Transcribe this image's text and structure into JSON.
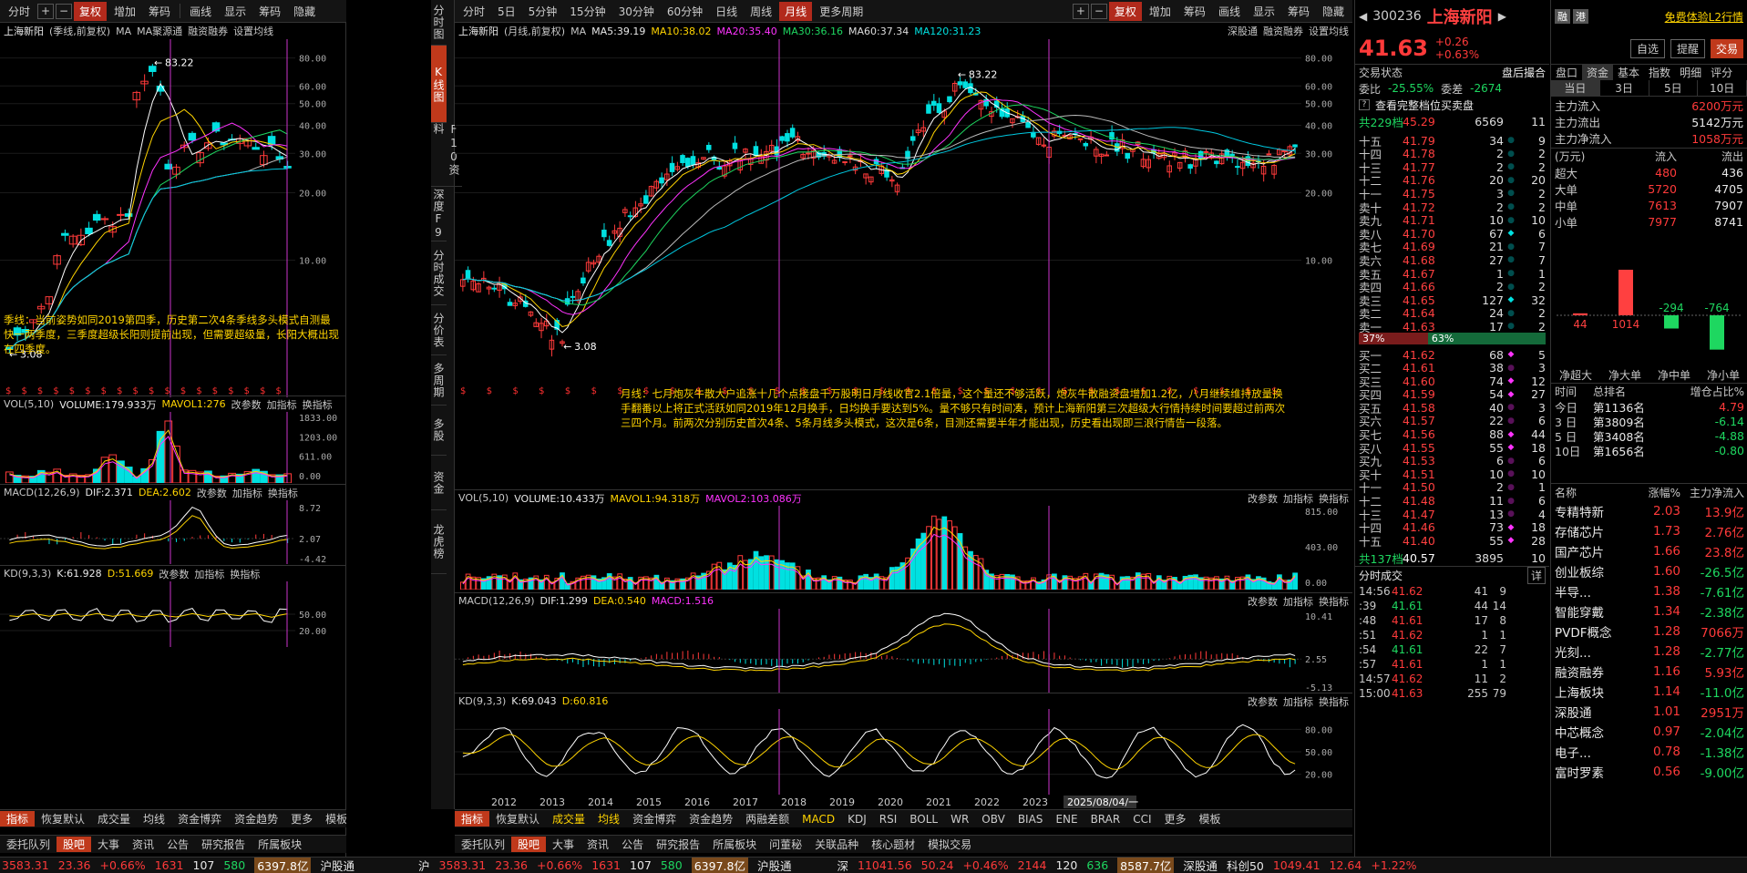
{
  "toolbar": {
    "left": [
      "分时",
      "+",
      "−",
      "复权",
      "增加",
      "筹码",
      "画线",
      "显示",
      "筹码",
      "隐藏"
    ],
    "mid": [
      "分时",
      "5日",
      "5分钟",
      "15分钟",
      "30分钟",
      "60分钟",
      "日线",
      "周线",
      "月线",
      "更多周期"
    ],
    "mid_right": [
      "+",
      "−",
      "复权",
      "增加",
      "筹码",
      "画线",
      "显示",
      "筹码",
      "隐藏"
    ]
  },
  "left_chart": {
    "title": "上海新阳",
    "sub": "(季线,前复权)",
    "ma_label": "MA",
    "ma2": "MA聚源通",
    "links": [
      "融资融券",
      "设置均线"
    ],
    "high": "83.22",
    "low": "3.08",
    "yticks": [
      "80.00",
      "60.00",
      "50.00",
      "40.00",
      "30.00",
      "20.00",
      "10.00"
    ],
    "note": "季线：当前姿势如同2019第四季，历史第二次4条季线多头模式自测最快一两季度，三季度超级长阳则提前出现，但需要超级量，长阳大概出现在四季度。",
    "vol": {
      "label": "VOL(5,10)",
      "volume": "VOLUME:179.933万",
      "mavol1": "MAVOL1:276",
      "links": [
        "改参数",
        "加指标",
        "换指标"
      ],
      "yticks": [
        "1833.00",
        "1203.00",
        "611.00",
        "0.00"
      ]
    },
    "macd": {
      "label": "MACD(12,26,9)",
      "dif": "DIF:2.371",
      "dea": "DEA:2.602",
      "links": [
        "改参数",
        "加指标",
        "换指标"
      ],
      "yticks": [
        "8.72",
        "2.07",
        "-4.42"
      ]
    },
    "kd": {
      "label": "KD(9,3,3)",
      "k": "K:61.928",
      "d": "D:51.669",
      "links": [
        "改参数",
        "加指标",
        "换指标"
      ],
      "yticks": [
        "50.00",
        "20.00"
      ]
    }
  },
  "side_tabs": [
    "分时图",
    "K线图",
    "F10资料",
    "深度F9",
    "分时成交",
    "分价表",
    "多周期",
    "多股",
    "资金",
    "龙虎榜"
  ],
  "main_chart": {
    "title": "上海新阳",
    "sub": "(月线,前复权)",
    "ma_label": "MA",
    "ma5": "MA5:39.19",
    "ma10": "MA10:38.02",
    "ma20": "MA20:35.40",
    "ma30": "MA30:36.16",
    "ma60": "MA60:37.34",
    "ma120": "MA120:31.23",
    "links": [
      "深股通",
      "融资融券",
      "设置均线"
    ],
    "high": "83.22",
    "low": "3.08",
    "yticks": [
      "80.00",
      "60.00",
      "50.00",
      "40.00",
      "30.00",
      "20.00",
      "10.00"
    ],
    "note": "月线：七月炮灰牛散大户追涨十几个点接盘千万股明日月线收官2.1倍量，这个量还不够活跃，炮灰牛散融资盘增加1.2亿，八月继续维持放量换手翻番以上将正式活跃如同2019年12月换手，日均换手要达到5%。量不够只有时间凑，预计上海新阳第三次超级大行情持续时间要超过前两次三四个月。前两次分别历史首次4条、5条月线多头模式，这次是6条，目测还需要半年才能出现，历史看出现即三浪行情告一段落。",
    "vol": {
      "label": "VOL(5,10)",
      "volume": "VOLUME:10.433万",
      "mavol1": "MAVOL1:94.318万",
      "mavol2": "MAVOL2:103.086万",
      "links": [
        "改参数",
        "加指标",
        "换指标"
      ],
      "yticks": [
        "815.00",
        "403.00",
        "0.00"
      ]
    },
    "macd": {
      "label": "MACD(12,26,9)",
      "dif": "DIF:1.299",
      "dea": "DEA:0.540",
      "macd": "MACD:1.516",
      "links": [
        "改参数",
        "加指标",
        "换指标"
      ],
      "yticks": [
        "10.41",
        "2.55",
        "-5.13"
      ]
    },
    "kd": {
      "label": "KD(9,3,3)",
      "k": "K:69.043",
      "d": "D:60.816",
      "links": [
        "改参数",
        "加指标",
        "换指标"
      ],
      "yticks": [
        "80.00",
        "50.00",
        "20.00"
      ]
    },
    "years": [
      "2012",
      "2013",
      "2014",
      "2015",
      "2016",
      "2017",
      "2018",
      "2019",
      "2020",
      "2021",
      "2022",
      "2023",
      "2"
    ],
    "cursor_date": "2025/08/04/一"
  },
  "bottom_left": {
    "row1": [
      "指标",
      "恢复默认",
      "成交量",
      "均线",
      "资金博弈",
      "资金趋势",
      "更多",
      "模板"
    ],
    "row2": [
      "委托队列",
      "股吧",
      "大事",
      "资讯",
      "公告",
      "研究报告",
      "所属板块"
    ]
  },
  "bottom_mid": {
    "row1": [
      "指标",
      "恢复默认",
      "成交量",
      "均线",
      "资金博弈",
      "资金趋势",
      "两融差额",
      "MACD",
      "KDJ",
      "RSI",
      "BOLL",
      "WR",
      "OBV",
      "BIAS",
      "ENE",
      "BRAR",
      "CCI",
      "更多",
      "模板"
    ],
    "row2": [
      "委托队列",
      "股吧",
      "大事",
      "资讯",
      "公告",
      "研究报告",
      "所属板块",
      "问董秘",
      "关联品种",
      "核心题材",
      "模拟交易"
    ]
  },
  "quote": {
    "code": "300236",
    "name": "上海新阳",
    "tags": [
      "融",
      "港"
    ],
    "promo": "免费体验L2行情",
    "price": "41.63",
    "chg": "+0.26",
    "pct": "+0.63%",
    "btn_self": "自选",
    "btn_alert": "提醒",
    "btn_trade": "交易",
    "status_label": "交易状态",
    "status_val": "盘后撮合",
    "wb_label": "委比",
    "wb_val": "-25.55%",
    "wc_label": "委差",
    "wc_val": "-2674",
    "view_all": "查看完整档位买卖盘",
    "sell_total": {
      "label": "共229档",
      "price": "45.29",
      "vol": "6569",
      "n": "11"
    },
    "sells": [
      {
        "l": "十五",
        "p": "41.79",
        "v": "34",
        "n": "9"
      },
      {
        "l": "十四",
        "p": "41.78",
        "v": "2",
        "n": "2"
      },
      {
        "l": "十三",
        "p": "41.77",
        "v": "2",
        "n": "2"
      },
      {
        "l": "十二",
        "p": "41.76",
        "v": "20",
        "n": "20"
      },
      {
        "l": "十一",
        "p": "41.75",
        "v": "3",
        "n": "2"
      },
      {
        "l": "卖十",
        "p": "41.72",
        "v": "2",
        "n": "2"
      },
      {
        "l": "卖九",
        "p": "41.71",
        "v": "10",
        "n": "10"
      },
      {
        "l": "卖八",
        "p": "41.70",
        "v": "67",
        "n": "6"
      },
      {
        "l": "卖七",
        "p": "41.69",
        "v": "21",
        "n": "7"
      },
      {
        "l": "卖六",
        "p": "41.68",
        "v": "27",
        "n": "7"
      },
      {
        "l": "卖五",
        "p": "41.67",
        "v": "1",
        "n": "1"
      },
      {
        "l": "卖四",
        "p": "41.66",
        "v": "2",
        "n": "2"
      },
      {
        "l": "卖三",
        "p": "41.65",
        "v": "127",
        "n": "32"
      },
      {
        "l": "卖二",
        "p": "41.64",
        "v": "24",
        "n": "2"
      },
      {
        "l": "卖一",
        "p": "41.63",
        "v": "17",
        "n": "2"
      }
    ],
    "ratio_left": "37%",
    "ratio_right": "63%",
    "buys": [
      {
        "l": "买一",
        "p": "41.62",
        "v": "68",
        "n": "5"
      },
      {
        "l": "买二",
        "p": "41.61",
        "v": "38",
        "n": "3"
      },
      {
        "l": "买三",
        "p": "41.60",
        "v": "74",
        "n": "12"
      },
      {
        "l": "买四",
        "p": "41.59",
        "v": "54",
        "n": "27"
      },
      {
        "l": "买五",
        "p": "41.58",
        "v": "40",
        "n": "3"
      },
      {
        "l": "买六",
        "p": "41.57",
        "v": "22",
        "n": "6"
      },
      {
        "l": "买七",
        "p": "41.56",
        "v": "88",
        "n": "44"
      },
      {
        "l": "买八",
        "p": "41.55",
        "v": "55",
        "n": "18"
      },
      {
        "l": "买九",
        "p": "41.53",
        "v": "6",
        "n": "6"
      },
      {
        "l": "买十",
        "p": "41.51",
        "v": "10",
        "n": "10"
      },
      {
        "l": "十一",
        "p": "41.50",
        "v": "2",
        "n": "1"
      },
      {
        "l": "十二",
        "p": "41.48",
        "v": "11",
        "n": "6"
      },
      {
        "l": "十三",
        "p": "41.47",
        "v": "13",
        "n": "4"
      },
      {
        "l": "十四",
        "p": "41.46",
        "v": "73",
        "n": "18"
      },
      {
        "l": "十五",
        "p": "41.40",
        "v": "55",
        "n": "28"
      }
    ],
    "buy_total": {
      "label": "共137档",
      "price": "40.57",
      "vol": "3895",
      "n": "10"
    },
    "ticks_title": "分时成交",
    "ticks_more": "详",
    "ticks": [
      {
        "t": "14:56",
        "p": "41.62",
        "v": "41",
        "n": "9",
        "c": "red",
        "a": ""
      },
      {
        "t": ":39",
        "p": "41.61",
        "v": "44",
        "n": "14",
        "c": "grn",
        "a": "↓"
      },
      {
        "t": ":48",
        "p": "41.61",
        "v": "17",
        "n": "8",
        "c": "red",
        "a": ""
      },
      {
        "t": ":51",
        "p": "41.62",
        "v": "1",
        "n": "1",
        "c": "red",
        "a": "↑"
      },
      {
        "t": ":54",
        "p": "41.61",
        "v": "22",
        "n": "7",
        "c": "grn",
        "a": "↓"
      },
      {
        "t": ":57",
        "p": "41.61",
        "v": "1",
        "n": "1",
        "c": "red",
        "a": ""
      },
      {
        "t": "14:57",
        "p": "41.62",
        "v": "11",
        "n": "2",
        "c": "red",
        "a": "↑"
      },
      {
        "t": "15:00",
        "p": "41.63",
        "v": "255",
        "n": "79",
        "c": "red",
        "a": "↑"
      }
    ]
  },
  "fund": {
    "tabs": [
      "盘口",
      "资金",
      "基本",
      "指数",
      "明细",
      "评分"
    ],
    "subtabs": [
      "当日",
      "3日",
      "5日",
      "10日"
    ],
    "main_in": {
      "l": "主力流入",
      "v": "6200万元"
    },
    "main_out": {
      "l": "主力流出",
      "v": "5142万元"
    },
    "main_net": {
      "l": "主力净流入",
      "v": "1058万元"
    },
    "unit": "(万元)",
    "hdr_in": "流入",
    "hdr_out": "流出",
    "rows": [
      {
        "l": "超大",
        "i": "480",
        "o": "436"
      },
      {
        "l": "大单",
        "i": "5720",
        "o": "4705"
      },
      {
        "l": "中单",
        "i": "7613",
        "o": "7907"
      },
      {
        "l": "小单",
        "i": "7977",
        "o": "8741"
      }
    ],
    "bars": [
      {
        "v": 44,
        "label": "44"
      },
      {
        "v": 1014,
        "label": "1014"
      },
      {
        "v": -294,
        "label": "-294"
      },
      {
        "v": -764,
        "label": "-764"
      }
    ],
    "bar_labels": [
      "净超大",
      "净大单",
      "净中单",
      "净小单"
    ],
    "rank_hdr": [
      "时间",
      "总排名",
      "增仓占比%"
    ],
    "ranks": [
      {
        "t": "今日",
        "r": "第1136名",
        "p": "4.79"
      },
      {
        "t": "3 日",
        "r": "第3809名",
        "p": "-6.14"
      },
      {
        "t": "5 日",
        "r": "第3408名",
        "p": "-4.88"
      },
      {
        "t": "10日",
        "r": "第1656名",
        "p": "-0.80"
      }
    ],
    "sector_hdr": [
      "名称",
      "涨幅%",
      "主力净流入"
    ],
    "sectors": [
      {
        "n": "专精特新",
        "p": "2.03",
        "f": "13.9亿"
      },
      {
        "n": "存储芯片",
        "p": "1.73",
        "f": "2.76亿"
      },
      {
        "n": "国产芯片",
        "p": "1.66",
        "f": "23.8亿"
      },
      {
        "n": "创业板综",
        "p": "1.60",
        "f": "-26.5亿"
      },
      {
        "n": "半导...",
        "p": "1.38",
        "f": "-7.61亿"
      },
      {
        "n": "智能穿戴",
        "p": "1.34",
        "f": "-2.38亿"
      },
      {
        "n": "PVDF概念",
        "p": "1.28",
        "f": "7066万"
      },
      {
        "n": "光刻...",
        "p": "1.28",
        "f": "-2.77亿"
      },
      {
        "n": "融资融券",
        "p": "1.16",
        "f": "5.93亿"
      },
      {
        "n": "上海板块",
        "p": "1.14",
        "f": "-11.0亿"
      },
      {
        "n": "深股通",
        "p": "1.01",
        "f": "2951万"
      },
      {
        "n": "中芯概念",
        "p": "0.97",
        "f": "-2.04亿"
      },
      {
        "n": "电子...",
        "p": "0.78",
        "f": "-1.38亿"
      },
      {
        "n": "富时罗素",
        "p": "0.56",
        "f": "-9.00亿"
      }
    ]
  },
  "status": {
    "s1": "3583.31",
    "s1c": "23.36",
    "s1p": "+0.66%",
    "s1v": "1631",
    "s1a": "107",
    "s1b": "580",
    "s1t": "6397.8亿",
    "hgt": "沪股通",
    "s2l": "沪",
    "s2": "3583.31",
    "s2c": "23.36",
    "s2p": "+0.66%",
    "s2v": "1631",
    "s2a": "107",
    "s2b": "580",
    "s2t": "6397.8亿",
    "hgt2": "沪股通",
    "s3l": "深",
    "s3": "11041.56",
    "s3c": "50.24",
    "s3p": "+0.46%",
    "s3v": "2144",
    "s3a": "120",
    "s3b": "636",
    "s3t": "8587.7亿",
    "sgt": "深股通",
    "kc": "科创50",
    "kcv": "1049.41",
    "kcc": "12.64",
    "kcp": "+1.22%"
  },
  "colors": {
    "up": "#ff3a3a",
    "down": "#00e0e0",
    "accent": "#c0391b"
  }
}
